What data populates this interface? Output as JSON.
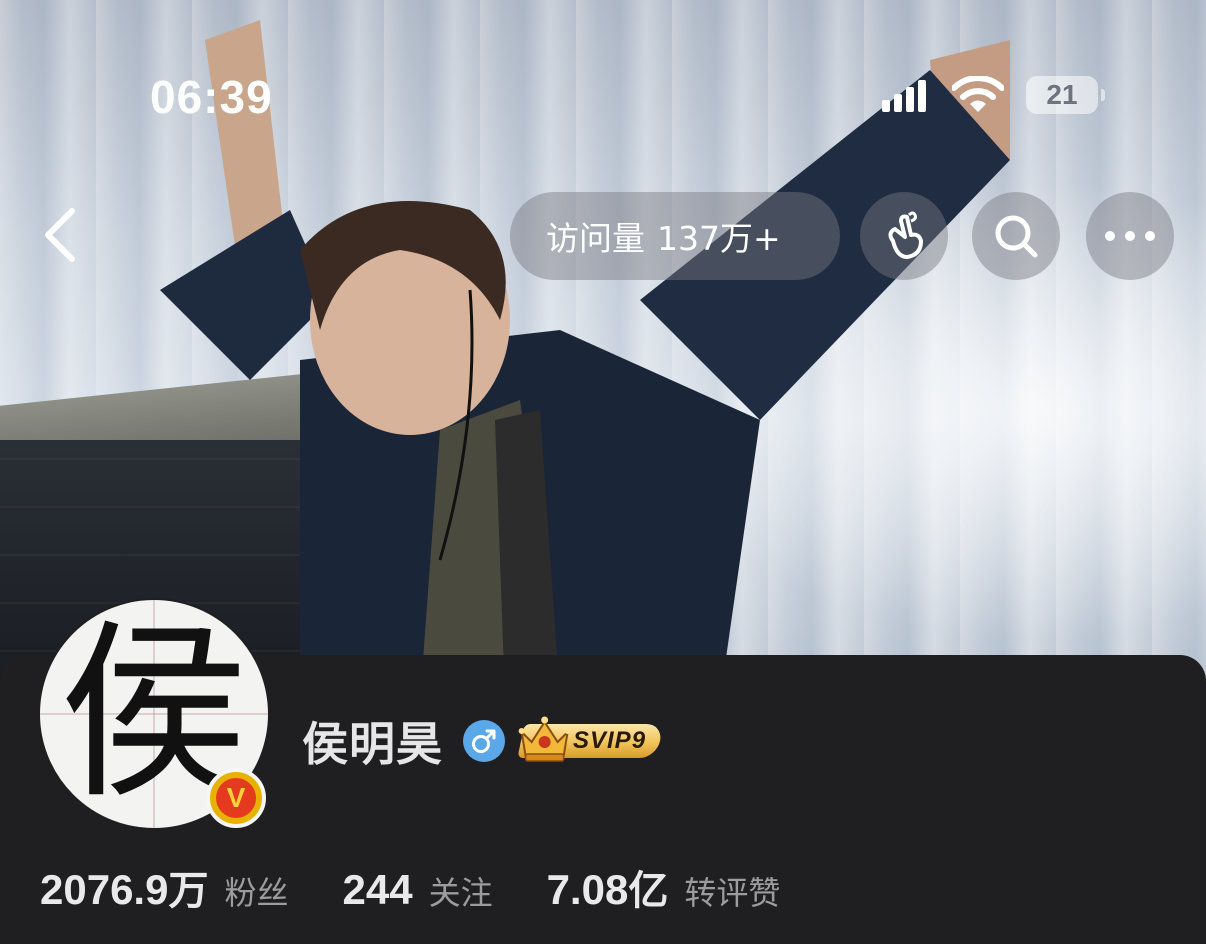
{
  "status_bar": {
    "time": "06:39",
    "battery": "21"
  },
  "nav": {
    "visits_label": "访问量",
    "visits_value": "137万+"
  },
  "profile": {
    "avatar_char": "侯",
    "verified_mark": "V",
    "name": "侯明昊",
    "gender": "male",
    "svip_label": "SVIP9"
  },
  "stats": [
    {
      "value": "2076.9",
      "unit": "万",
      "label": "粉丝"
    },
    {
      "value": "244",
      "unit": "",
      "label": "关注"
    },
    {
      "value": "7.08",
      "unit": "亿",
      "label": "转评赞"
    }
  ],
  "colors": {
    "panel_bg": "#1f1f21",
    "gender_blue": "#5aa8e8",
    "verified_gold": "#e8b200",
    "verified_red": "#e63a1f",
    "svip_gold": "#f0c35a"
  },
  "icons": [
    "back-chevron-icon",
    "finger-heart-icon",
    "search-icon",
    "more-icon",
    "signal-icon",
    "wifi-icon",
    "male-icon",
    "crown-icon"
  ]
}
